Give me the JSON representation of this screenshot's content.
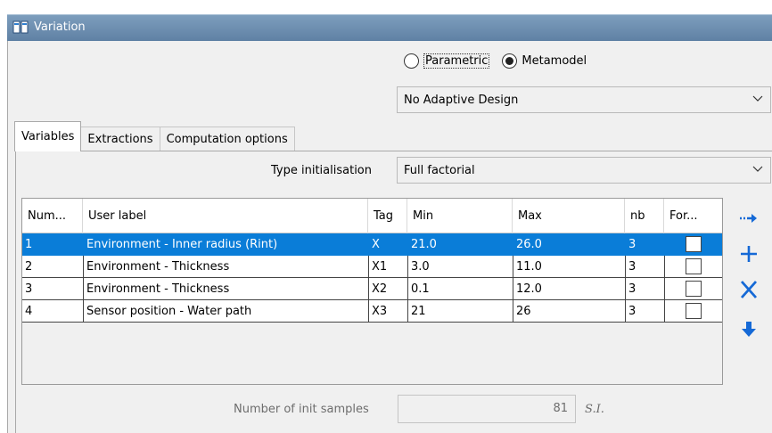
{
  "window": {
    "title": "Variation",
    "controls": [
      "restore-icon",
      "pin-icon",
      "close-icon"
    ]
  },
  "mode": {
    "options": [
      {
        "label": "Parametric",
        "checked": false
      },
      {
        "label": "Metamodel",
        "checked": true
      }
    ]
  },
  "adaptive_design": {
    "value": "No Adaptive Design"
  },
  "tabs": [
    {
      "label": "Variables",
      "active": true
    },
    {
      "label": "Extractions",
      "active": false
    },
    {
      "label": "Computation options",
      "active": false
    }
  ],
  "type_init": {
    "label": "Type initialisation",
    "value": "Full factorial"
  },
  "table": {
    "headers": [
      "Num...",
      "User label",
      "Tag",
      "Min",
      "Max",
      "nb",
      "For..."
    ],
    "rows": [
      {
        "num": "1",
        "label": "Environment - Inner radius (Rint)",
        "tag": "X",
        "min": "21.0",
        "max": "26.0",
        "nb": "3",
        "forced": false,
        "selected": true
      },
      {
        "num": "2",
        "label": "Environment - Thickness",
        "tag": "X1",
        "min": "3.0",
        "max": "11.0",
        "nb": "3",
        "forced": false,
        "selected": false
      },
      {
        "num": "3",
        "label": "Environment - Thickness",
        "tag": "X2",
        "min": "0.1",
        "max": "12.0",
        "nb": "3",
        "forced": false,
        "selected": false
      },
      {
        "num": "4",
        "label": "Sensor position - Water path",
        "tag": "X3",
        "min": "21",
        "max": "26",
        "nb": "3",
        "forced": false,
        "selected": false
      }
    ]
  },
  "side_actions": [
    "insert-after-icon",
    "add-icon",
    "delete-icon",
    "move-down-icon"
  ],
  "samples": {
    "label": "Number of init samples",
    "value": "81",
    "unit": "S.I."
  },
  "colors": {
    "selection": "#0a7dd8",
    "titlebar": "#6f90b2",
    "action_blue": "#1569d6"
  }
}
